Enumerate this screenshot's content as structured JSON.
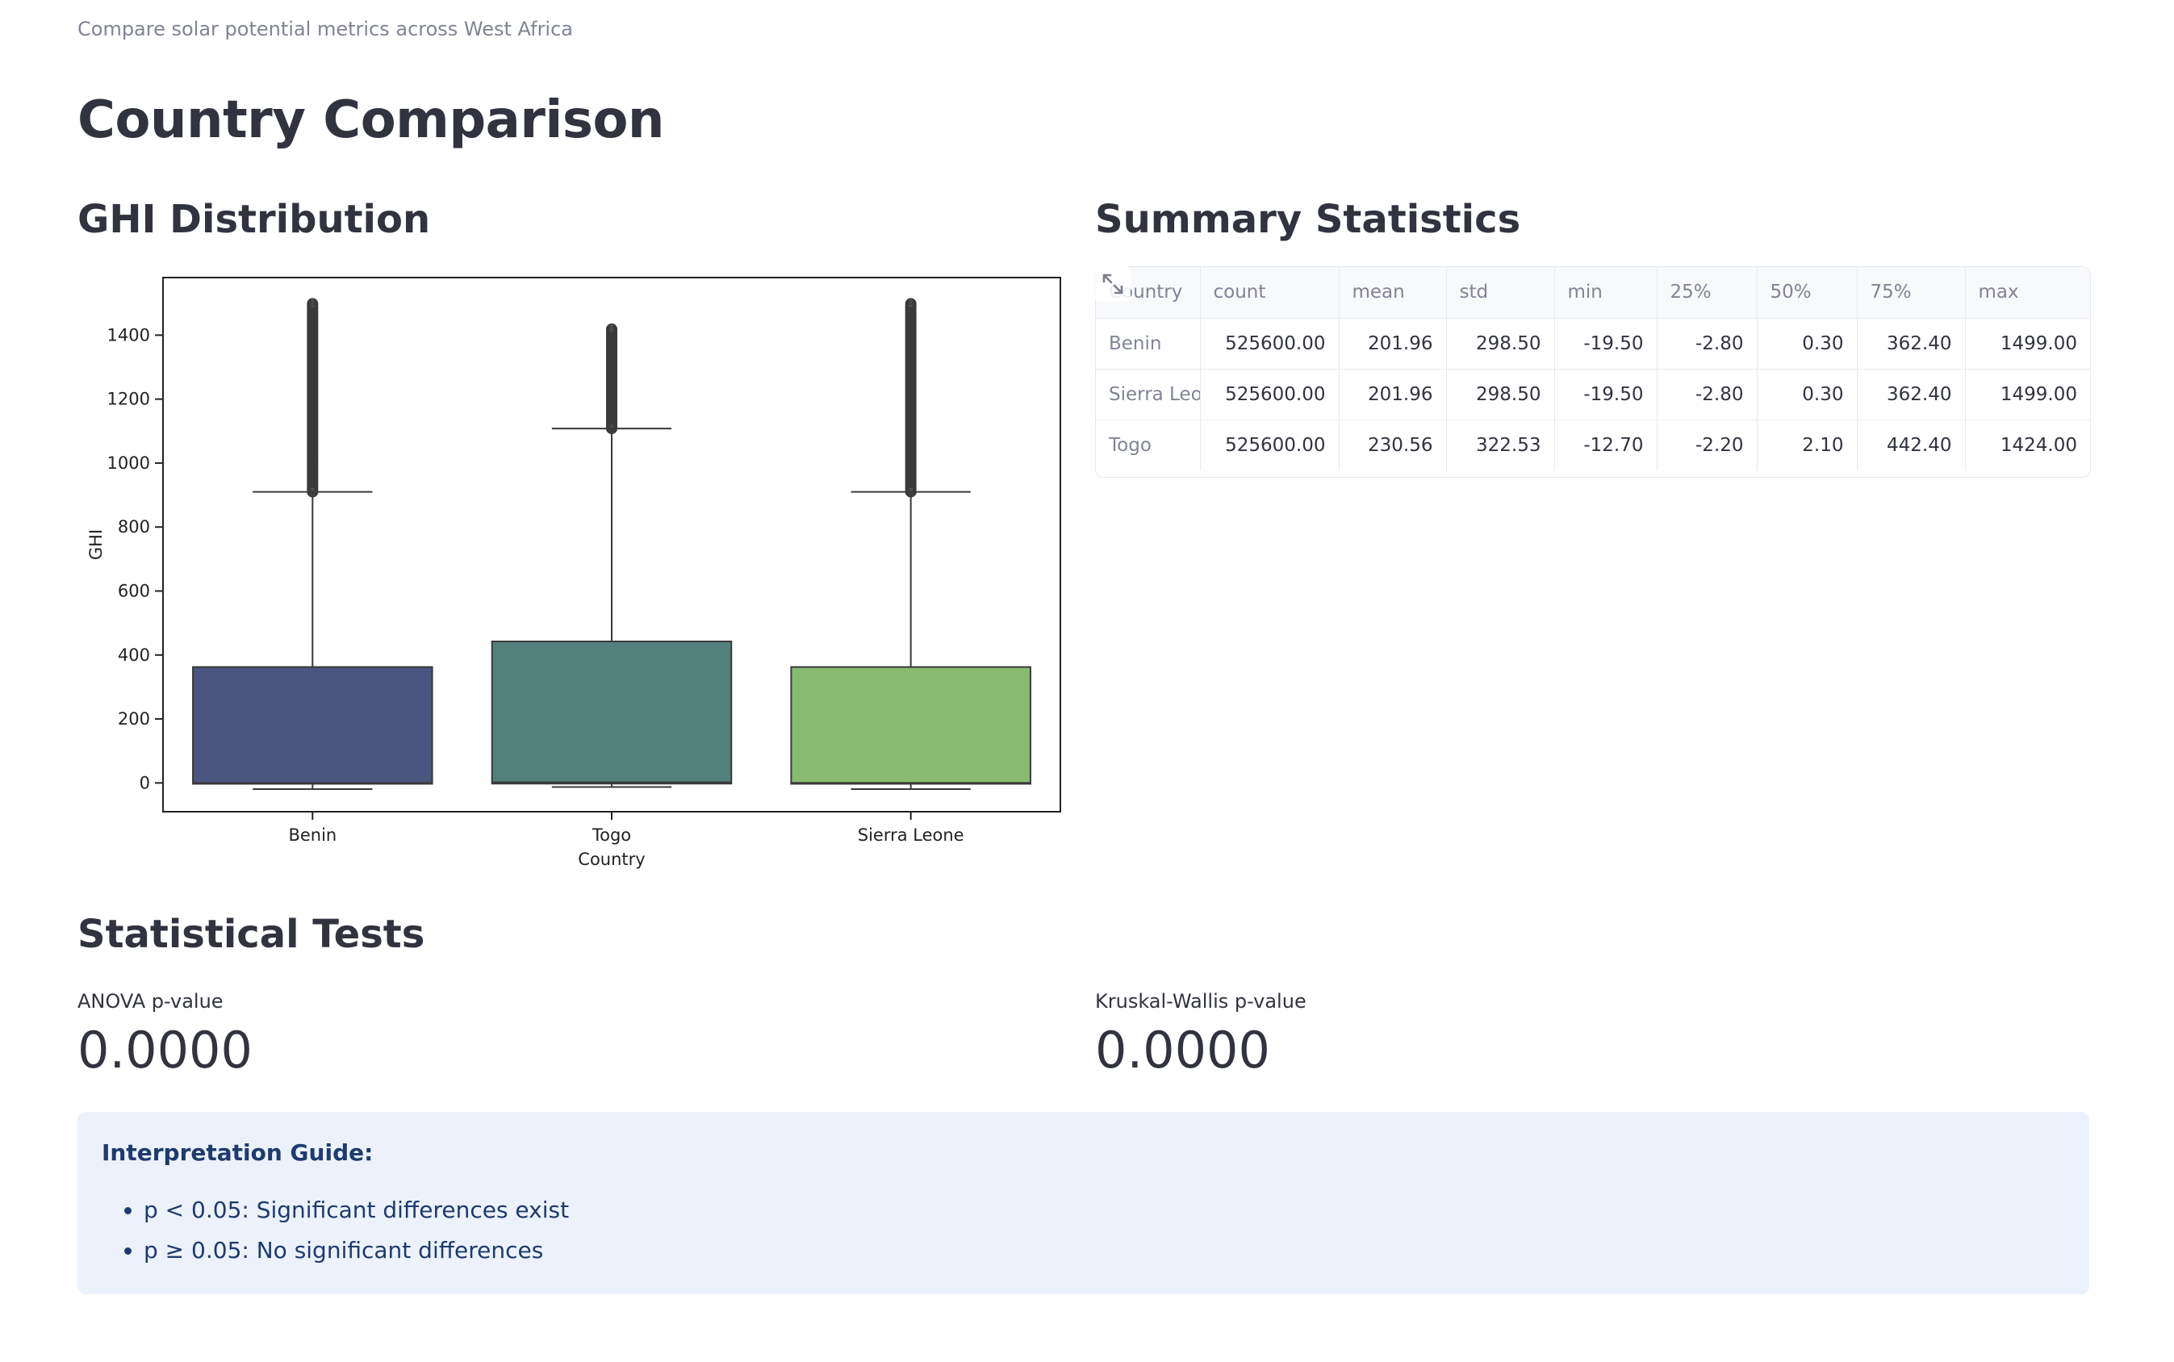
{
  "header": {
    "caption": "Compare solar potential metrics across West Africa",
    "title": "Country Comparison"
  },
  "sections": {
    "distribution_title": "GHI Distribution",
    "summary_title": "Summary Statistics",
    "tests_title": "Statistical Tests"
  },
  "chart_data": {
    "type": "box",
    "xlabel": "Country",
    "ylabel": "GHI",
    "ylim": [
      -90,
      1580
    ],
    "yticks": [
      0,
      200,
      400,
      600,
      800,
      1000,
      1200,
      1400
    ],
    "categories": [
      "Benin",
      "Togo",
      "Sierra Leone"
    ],
    "colors": [
      "#4a567f",
      "#52817c",
      "#87bc70"
    ],
    "boxes": [
      {
        "name": "Benin",
        "min": -19.5,
        "q1": -2.8,
        "median": 0.3,
        "q3": 362.4,
        "whisker_high": 910,
        "max": 1499.0,
        "outlier_from": 910
      },
      {
        "name": "Togo",
        "min": -12.7,
        "q1": -2.2,
        "median": 2.1,
        "q3": 442.4,
        "whisker_high": 1108,
        "max": 1424.0,
        "outlier_from": 1108
      },
      {
        "name": "Sierra Leone",
        "min": -19.5,
        "q1": -2.8,
        "median": 0.3,
        "q3": 362.4,
        "whisker_high": 910,
        "max": 1499.0,
        "outlier_from": 910
      }
    ]
  },
  "summary_table": {
    "columns": [
      "Country",
      "count",
      "mean",
      "std",
      "min",
      "25%",
      "50%",
      "75%",
      "max"
    ],
    "rows": [
      [
        "Benin",
        "525600.00",
        "201.96",
        "298.50",
        "-19.50",
        "-2.80",
        "0.30",
        "362.40",
        "1499.00"
      ],
      [
        "Sierra Leone",
        "525600.00",
        "201.96",
        "298.50",
        "-19.50",
        "-2.80",
        "0.30",
        "362.40",
        "1499.00"
      ],
      [
        "Togo",
        "525600.00",
        "230.56",
        "322.53",
        "-12.70",
        "-2.20",
        "2.10",
        "442.40",
        "1424.00"
      ]
    ],
    "expand_icon": "expand-icon"
  },
  "metrics": {
    "anova": {
      "label": "ANOVA p-value",
      "value": "0.0000"
    },
    "kruskal": {
      "label": "Kruskal-Wallis p-value",
      "value": "0.0000"
    }
  },
  "info": {
    "title": "Interpretation Guide:",
    "items": [
      "p < 0.05: Significant differences exist",
      "p ≥ 0.05: No significant differences"
    ]
  }
}
